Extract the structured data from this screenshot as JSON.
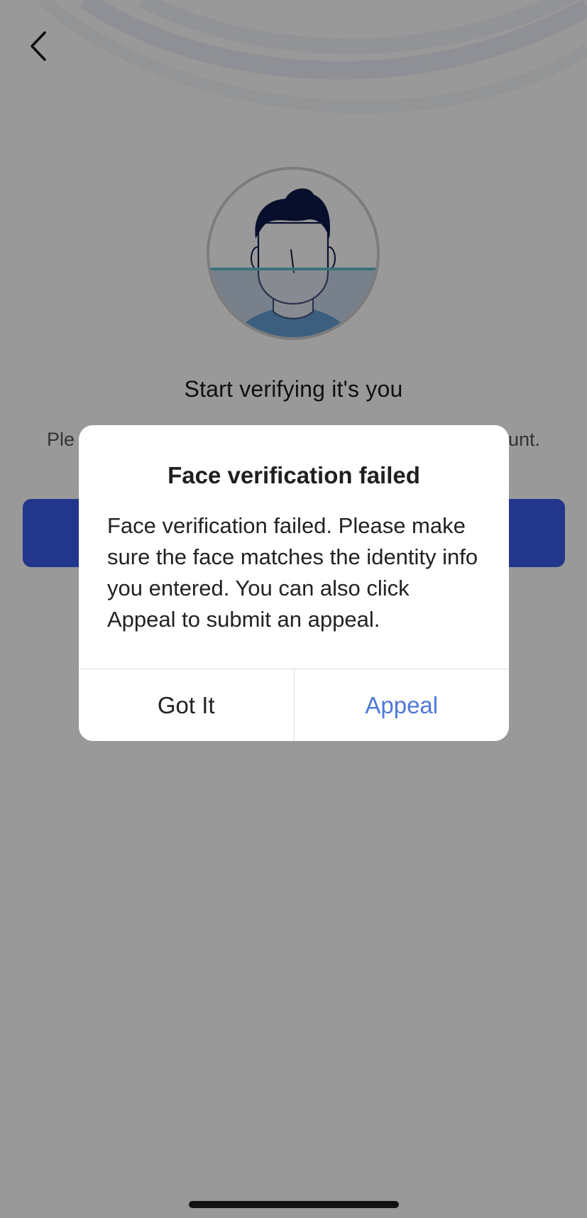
{
  "header": {
    "back_icon": "chevron-left-icon"
  },
  "main": {
    "illustration_icon": "face-scan-icon",
    "title": "Start verifying it's you",
    "subtitle_left": "Ple",
    "subtitle_right": "unt.",
    "primary_button": ""
  },
  "dialog": {
    "title": "Face verification failed",
    "body": "Face verification failed. Please make sure the face matches the identity info you entered. You can also click Appeal to submit an appeal.",
    "got_it_label": "Got It",
    "appeal_label": "Appeal"
  },
  "colors": {
    "primary": "#3a5ce9",
    "appeal_link": "#4e79d6",
    "overlay": "rgba(0,0,0,0.4)",
    "face_hair": "#0e1a4a",
    "shirt": "#3f8fd6",
    "scan_line": "#5fbfc9"
  }
}
